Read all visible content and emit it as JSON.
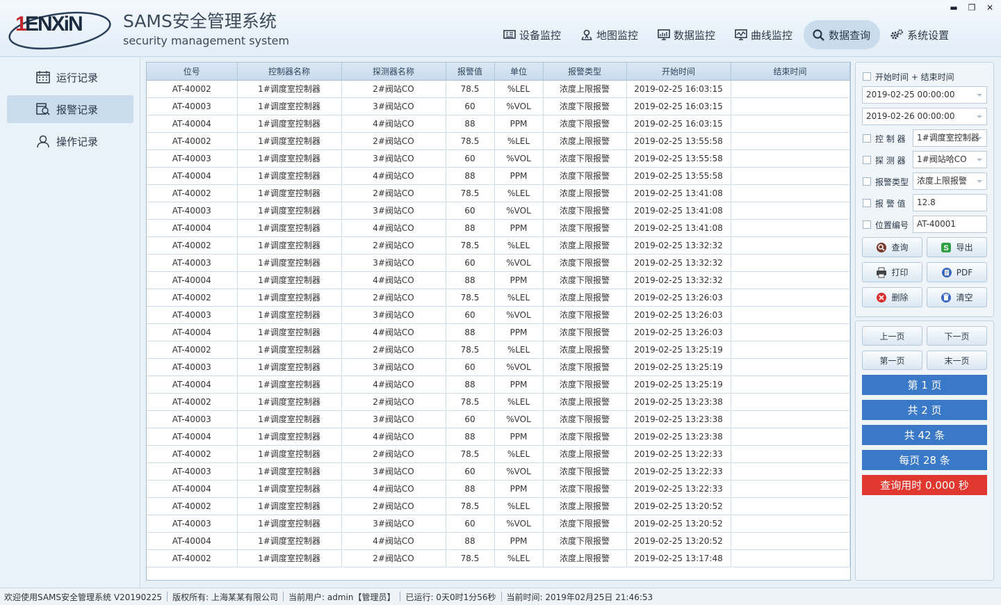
{
  "app": {
    "logo_text": "ENXIN",
    "title": "SAMS安全管理系统",
    "subtitle": "security management system",
    "accent": "#3a78c8",
    "alert_color": "#e0382f"
  },
  "window_controls": {
    "minimize": "▬",
    "restore": "❐",
    "close": "✕"
  },
  "nav": [
    {
      "label": "设备监控",
      "icon": "device-monitor-icon",
      "active": false
    },
    {
      "label": "地图监控",
      "icon": "map-monitor-icon",
      "active": false
    },
    {
      "label": "数据监控",
      "icon": "data-monitor-icon",
      "active": false
    },
    {
      "label": "曲线监控",
      "icon": "curve-monitor-icon",
      "active": false
    },
    {
      "label": "数据查询",
      "icon": "search-icon",
      "active": true
    },
    {
      "label": "系统设置",
      "icon": "gear-icon",
      "active": false
    }
  ],
  "sidebar": [
    {
      "label": "运行记录",
      "icon": "calendar-icon",
      "active": false
    },
    {
      "label": "报警记录",
      "icon": "alarm-record-icon",
      "active": true
    },
    {
      "label": "操作记录",
      "icon": "user-icon",
      "active": false
    }
  ],
  "table": {
    "columns": [
      "位号",
      "控制器名称",
      "探测器名称",
      "报警值",
      "单位",
      "报警类型",
      "开始时间",
      "结束时间"
    ],
    "rows": [
      [
        "AT-40002",
        "1#调度室控制器",
        "2#阀站CO",
        "78.5",
        "%LEL",
        "浓度上限报警",
        "2019-02-25 16:03:15",
        ""
      ],
      [
        "AT-40003",
        "1#调度室控制器",
        "3#阀站CO",
        "60",
        "%VOL",
        "浓度下限报警",
        "2019-02-25 16:03:15",
        ""
      ],
      [
        "AT-40004",
        "1#调度室控制器",
        "4#阀站CO",
        "88",
        "PPM",
        "浓度下限报警",
        "2019-02-25 16:03:15",
        ""
      ],
      [
        "AT-40002",
        "1#调度室控制器",
        "2#阀站CO",
        "78.5",
        "%LEL",
        "浓度上限报警",
        "2019-02-25 13:55:58",
        ""
      ],
      [
        "AT-40003",
        "1#调度室控制器",
        "3#阀站CO",
        "60",
        "%VOL",
        "浓度下限报警",
        "2019-02-25 13:55:58",
        ""
      ],
      [
        "AT-40004",
        "1#调度室控制器",
        "4#阀站CO",
        "88",
        "PPM",
        "浓度下限报警",
        "2019-02-25 13:55:58",
        ""
      ],
      [
        "AT-40002",
        "1#调度室控制器",
        "2#阀站CO",
        "78.5",
        "%LEL",
        "浓度上限报警",
        "2019-02-25 13:41:08",
        ""
      ],
      [
        "AT-40003",
        "1#调度室控制器",
        "3#阀站CO",
        "60",
        "%VOL",
        "浓度下限报警",
        "2019-02-25 13:41:08",
        ""
      ],
      [
        "AT-40004",
        "1#调度室控制器",
        "4#阀站CO",
        "88",
        "PPM",
        "浓度下限报警",
        "2019-02-25 13:41:08",
        ""
      ],
      [
        "AT-40002",
        "1#调度室控制器",
        "2#阀站CO",
        "78.5",
        "%LEL",
        "浓度上限报警",
        "2019-02-25 13:32:32",
        ""
      ],
      [
        "AT-40003",
        "1#调度室控制器",
        "3#阀站CO",
        "60",
        "%VOL",
        "浓度下限报警",
        "2019-02-25 13:32:32",
        ""
      ],
      [
        "AT-40004",
        "1#调度室控制器",
        "4#阀站CO",
        "88",
        "PPM",
        "浓度下限报警",
        "2019-02-25 13:32:32",
        ""
      ],
      [
        "AT-40002",
        "1#调度室控制器",
        "2#阀站CO",
        "78.5",
        "%LEL",
        "浓度上限报警",
        "2019-02-25 13:26:03",
        ""
      ],
      [
        "AT-40003",
        "1#调度室控制器",
        "3#阀站CO",
        "60",
        "%VOL",
        "浓度下限报警",
        "2019-02-25 13:26:03",
        ""
      ],
      [
        "AT-40004",
        "1#调度室控制器",
        "4#阀站CO",
        "88",
        "PPM",
        "浓度下限报警",
        "2019-02-25 13:26:03",
        ""
      ],
      [
        "AT-40002",
        "1#调度室控制器",
        "2#阀站CO",
        "78.5",
        "%LEL",
        "浓度上限报警",
        "2019-02-25 13:25:19",
        ""
      ],
      [
        "AT-40003",
        "1#调度室控制器",
        "3#阀站CO",
        "60",
        "%VOL",
        "浓度下限报警",
        "2019-02-25 13:25:19",
        ""
      ],
      [
        "AT-40004",
        "1#调度室控制器",
        "4#阀站CO",
        "88",
        "PPM",
        "浓度下限报警",
        "2019-02-25 13:25:19",
        ""
      ],
      [
        "AT-40002",
        "1#调度室控制器",
        "2#阀站CO",
        "78.5",
        "%LEL",
        "浓度上限报警",
        "2019-02-25 13:23:38",
        ""
      ],
      [
        "AT-40003",
        "1#调度室控制器",
        "3#阀站CO",
        "60",
        "%VOL",
        "浓度下限报警",
        "2019-02-25 13:23:38",
        ""
      ],
      [
        "AT-40004",
        "1#调度室控制器",
        "4#阀站CO",
        "88",
        "PPM",
        "浓度下限报警",
        "2019-02-25 13:23:38",
        ""
      ],
      [
        "AT-40002",
        "1#调度室控制器",
        "2#阀站CO",
        "78.5",
        "%LEL",
        "浓度上限报警",
        "2019-02-25 13:22:33",
        ""
      ],
      [
        "AT-40003",
        "1#调度室控制器",
        "3#阀站CO",
        "60",
        "%VOL",
        "浓度下限报警",
        "2019-02-25 13:22:33",
        ""
      ],
      [
        "AT-40004",
        "1#调度室控制器",
        "4#阀站CO",
        "88",
        "PPM",
        "浓度下限报警",
        "2019-02-25 13:22:33",
        ""
      ],
      [
        "AT-40002",
        "1#调度室控制器",
        "2#阀站CO",
        "78.5",
        "%LEL",
        "浓度上限报警",
        "2019-02-25 13:20:52",
        ""
      ],
      [
        "AT-40003",
        "1#调度室控制器",
        "3#阀站CO",
        "60",
        "%VOL",
        "浓度下限报警",
        "2019-02-25 13:20:52",
        ""
      ],
      [
        "AT-40004",
        "1#调度室控制器",
        "4#阀站CO",
        "88",
        "PPM",
        "浓度下限报警",
        "2019-02-25 13:20:52",
        ""
      ],
      [
        "AT-40002",
        "1#调度室控制器",
        "2#阀站CO",
        "78.5",
        "%LEL",
        "浓度上限报警",
        "2019-02-25 13:17:48",
        ""
      ]
    ]
  },
  "filters": {
    "time_label": "开始时间 + 结束时间",
    "start_time": "2019-02-25 00:00:00",
    "end_time": "2019-02-26 00:00:00",
    "controller_label": "控 制 器",
    "controller_value": "1#调度室控制器",
    "detector_label": "探 测 器",
    "detector_value": "1#阀站哈CO",
    "alarm_type_label": "报警类型",
    "alarm_type_value": "浓度上限报警",
    "alarm_value_label": "报 警 值",
    "alarm_value": "12.8",
    "position_label": "位置编号",
    "position_value": "AT-40001"
  },
  "actions": {
    "query": "查询",
    "export": "导出",
    "print": "打印",
    "pdf": "PDF",
    "delete": "删除",
    "clear": "清空"
  },
  "pager": {
    "prev": "上一页",
    "next": "下一页",
    "first": "第一页",
    "last": "末一页",
    "current_page": "第 1 页",
    "total_pages": "共 2 页",
    "total_records": "共 42 条",
    "per_page": "每页 28 条",
    "query_time": "查询用时 0.000 秒"
  },
  "status": {
    "welcome": "欢迎使用SAMS安全管理系统 V20190225",
    "copyright": "版权所有: 上海某某有限公司",
    "current_user": "当前用户: admin【管理员】",
    "uptime": "已运行: 0天0时1分56秒",
    "current_time": "当前时间: 2019年02月25日 21:46:53"
  }
}
